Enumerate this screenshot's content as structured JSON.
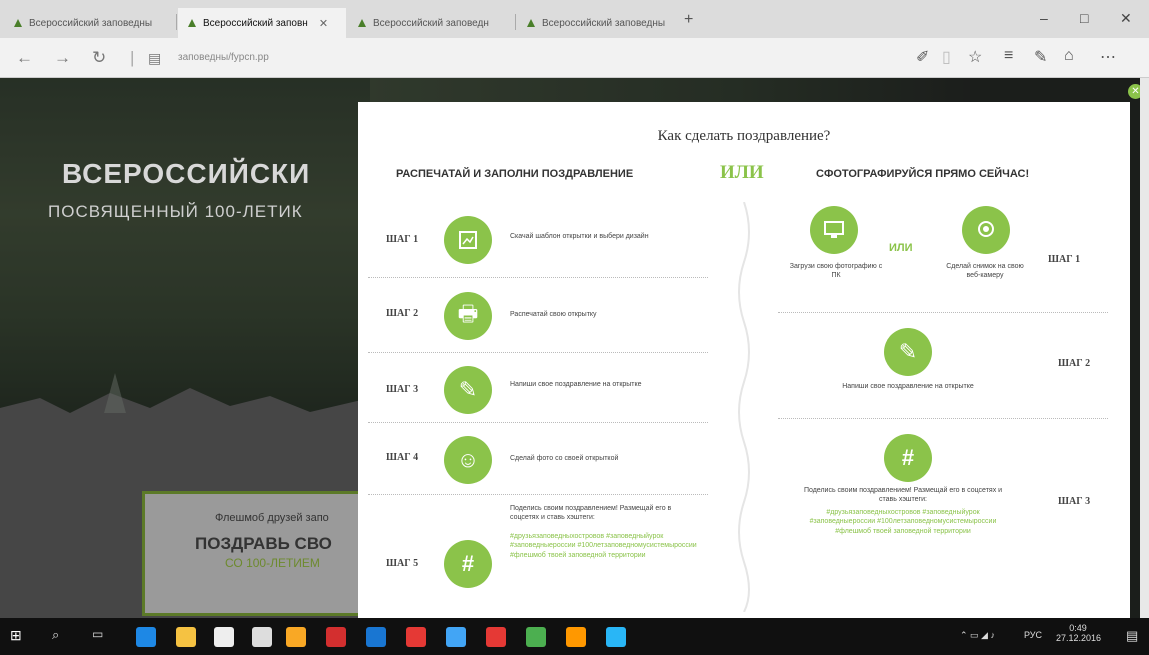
{
  "browser": {
    "tabs": [
      {
        "label": "Всероссийский заповедны",
        "active": false
      },
      {
        "label": "Всероссийский заповн",
        "active": true
      },
      {
        "label": "Всероссийский заповедн",
        "active": false
      },
      {
        "label": "Всероссийский заповедны",
        "active": false
      }
    ],
    "url": "заповедны/fypcn.pp",
    "window": {
      "minimize": "–",
      "maximize": "□",
      "close": "✕"
    }
  },
  "page": {
    "hero_title": "ВСЕРОССИЙСКИ",
    "hero_subtitle": "ПОСВЯЩЕННЫЙ 100-ЛЕТИК",
    "card": {
      "line1": "Флешмоб друзей запо",
      "line2": "ПОЗДРАВЬ СВО",
      "line3": "СО 100-ЛЕТИЕМ"
    }
  },
  "modal": {
    "title": "Как сделать поздравление?",
    "left_header": "РАСПЕЧАТАЙ И ЗАПОЛНИ ПОЗДРАВЛЕНИЕ",
    "or_big": "ИЛИ",
    "right_header": "СФОТОГРАФИРУЙСЯ ПРЯМО СЕЙЧАС!",
    "left_steps": [
      {
        "label": "ШАГ 1",
        "icon": "#",
        "text": "Скачай шаблон открытки и выбери дизайн",
        "link": "Скачай"
      },
      {
        "label": "ШАГ 2",
        "text": "Распечатай свою открытку"
      },
      {
        "label": "ШАГ 3",
        "text": "Напиши свое поздравление на открытке"
      },
      {
        "label": "ШАГ 4",
        "text": "Сделай фото со своей открыткой"
      },
      {
        "label": "ШАГ 5",
        "icon": "#",
        "text": "Поделись своим поздравлением! Размещай его в соцсетях и ставь хэштеги:",
        "tags": "#друзьязаповедныхостровов #заповедныйурок #заповедныероссии #100летзаповедномусистемыроссии #флешмоб твоей заповедной территории"
      }
    ],
    "right_steps": [
      {
        "label": "ШАГ 1",
        "upload": "Загрузи свою фотографию с ПК",
        "or": "ИЛИ",
        "camera": "Сделай снимок на свою веб-камеру"
      },
      {
        "label": "ШАГ 2",
        "text": "Напиши свое поздравление на открытке"
      },
      {
        "label": "ШАГ 3",
        "icon": "#",
        "text": "Поделись своим поздравлением! Размещай его в соцсетях и ставь хэштеги:",
        "tags": "#друзьязаповедныхостровов #заповедныйурок #заповедныероссии #100летзаповедномусистемыроссии #флешмоб твоей заповедной территории"
      }
    ]
  },
  "taskbar": {
    "lang": "РУС",
    "time": "0:49",
    "date": "27.12.2016"
  }
}
